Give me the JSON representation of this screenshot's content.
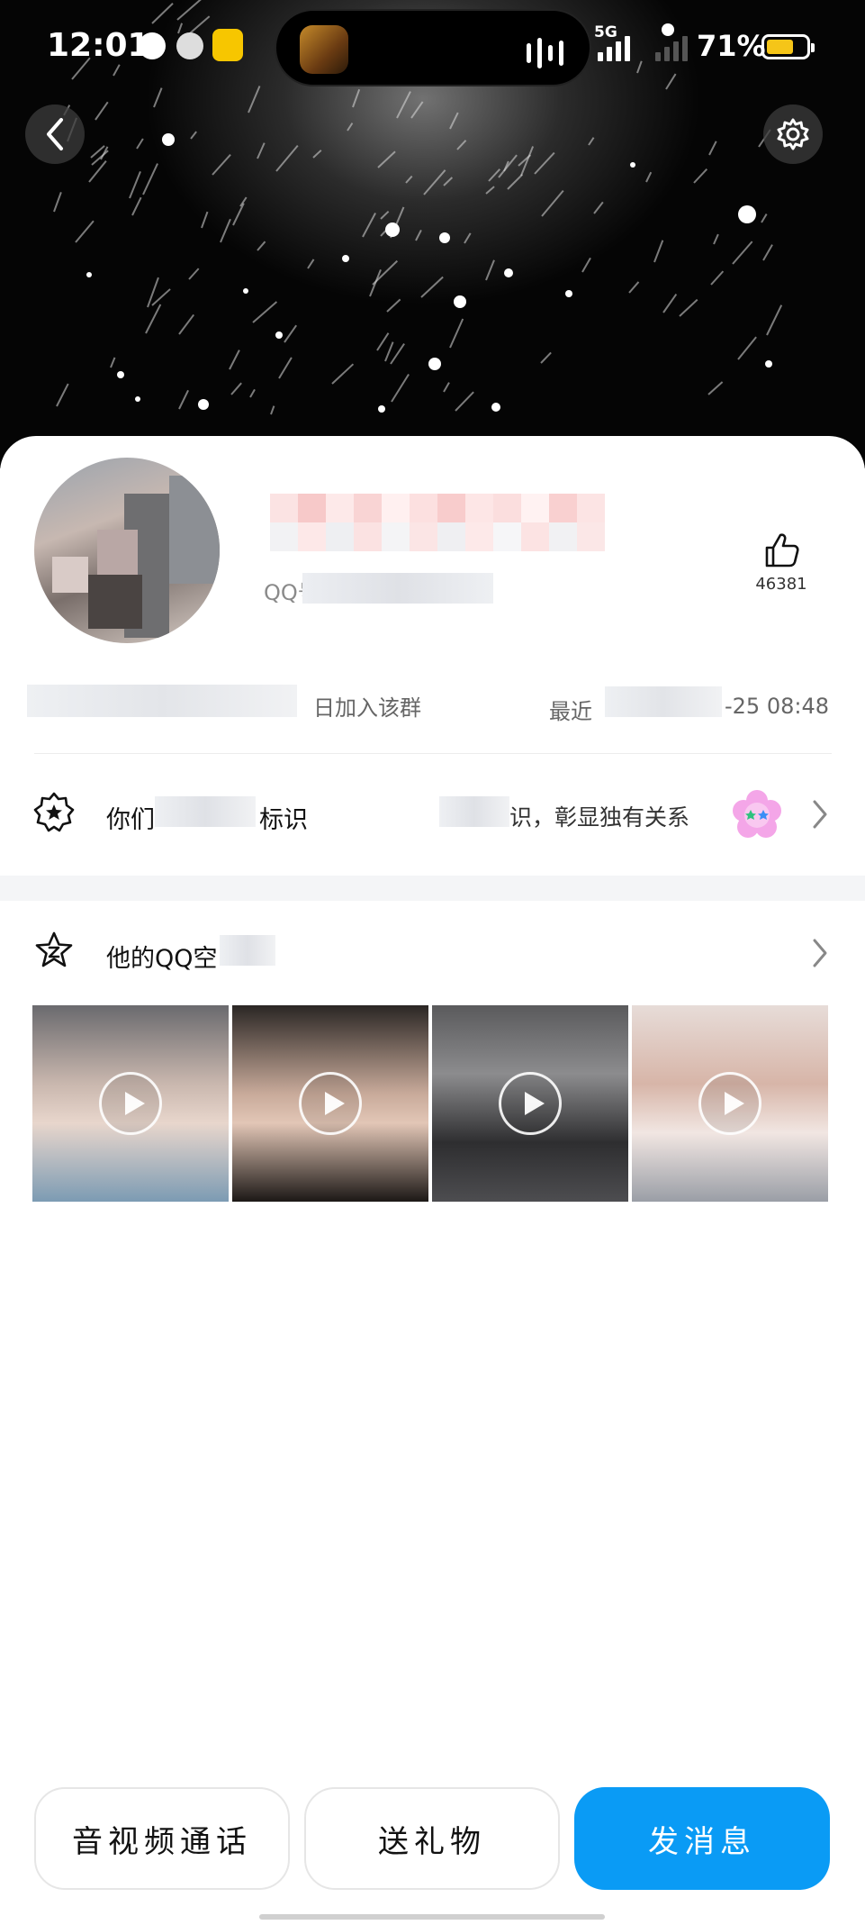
{
  "status_bar": {
    "time": "12:01",
    "network": "5G",
    "battery_percent": "71%",
    "battery_level": 0.7,
    "battery_color": "#f5c518"
  },
  "header": {
    "back_icon": "chevron-left-icon",
    "settings_icon": "gear-icon",
    "background": "night-sky"
  },
  "profile": {
    "qq_label": "QQ号",
    "like_icon": "thumbs-up-icon",
    "like_count": "46381",
    "join_text": "日加入该群",
    "recent_label": "最近",
    "recent_time": "-25 08:48"
  },
  "identity_row": {
    "icon": "star-badge-icon",
    "label_prefix": "你们",
    "label_suffix": "标识",
    "description": "识，彰显独有关系",
    "badge_icon": "flower-stars-icon"
  },
  "zone_row": {
    "icon": "zone-icon",
    "label": "他的QQ空"
  },
  "zone_thumbnails": [
    {
      "type": "video"
    },
    {
      "type": "video"
    },
    {
      "type": "video"
    },
    {
      "type": "video"
    }
  ],
  "actions": {
    "call_label": "音视频通话",
    "gift_label": "送礼物",
    "message_label": "发消息"
  },
  "colors": {
    "primary": "#0a9bf5",
    "card_background": "#ffffff",
    "header_background": "#050505"
  }
}
